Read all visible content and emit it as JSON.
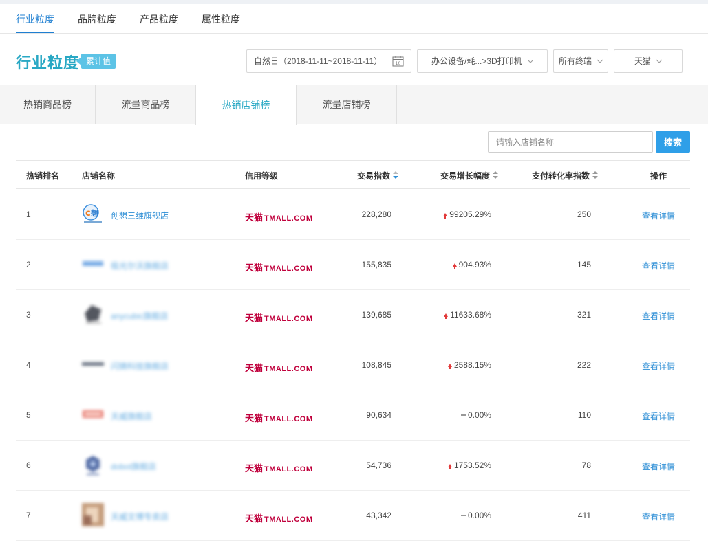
{
  "subnav": {
    "items": [
      "行业粒度",
      "品牌粒度",
      "产品粒度",
      "属性粒度"
    ],
    "active_index": 0
  },
  "header": {
    "title": "行业粒度",
    "badge": "累计值"
  },
  "filters": {
    "date": "自然日（2018-11-11~2018-11-11）",
    "category": "办公设备/耗...>3D打印机",
    "terminal": "所有终端",
    "platform": "天猫"
  },
  "tabs": {
    "items": [
      "热销商品榜",
      "流量商品榜",
      "热销店铺榜",
      "流量店铺榜"
    ],
    "active_index": 2
  },
  "search": {
    "placeholder": "请输入店铺名称",
    "button": "搜索"
  },
  "table": {
    "columns": {
      "rank": "热销排名",
      "shop": "店铺名称",
      "credit": "信用等级",
      "trade": "交易指数",
      "growth": "交易增长幅度",
      "conversion": "支付转化率指数",
      "action": "操作"
    },
    "credit_label_zh": "天猫",
    "credit_label_en": "TMALL.COM",
    "action_label": "查看详情",
    "rows": [
      {
        "rank": "1",
        "shop": "创想三维旗舰店",
        "blurred": false,
        "trade": "228,280",
        "growth": "99205.29%",
        "trend": "up",
        "conversion": "250"
      },
      {
        "rank": "2",
        "shop": "极光尔沃旗舰店",
        "blurred": true,
        "trade": "155,835",
        "growth": "904.93%",
        "trend": "up",
        "conversion": "145"
      },
      {
        "rank": "3",
        "shop": "anycubic旗舰店",
        "blurred": true,
        "trade": "139,685",
        "growth": "11633.68%",
        "trend": "up",
        "conversion": "321"
      },
      {
        "rank": "4",
        "shop": "闪铸科技旗舰店",
        "blurred": true,
        "trade": "108,845",
        "growth": "2588.15%",
        "trend": "up",
        "conversion": "222"
      },
      {
        "rank": "5",
        "shop": "天威旗舰店",
        "blurred": true,
        "trade": "90,634",
        "growth": "0.00%",
        "trend": "flat",
        "conversion": "110"
      },
      {
        "rank": "6",
        "shop": "dobot旗舰店",
        "blurred": true,
        "trade": "54,736",
        "growth": "1753.52%",
        "trend": "up",
        "conversion": "78"
      },
      {
        "rank": "7",
        "shop": "天威文博专卖店",
        "blurred": true,
        "trade": "43,342",
        "growth": "0.00%",
        "trend": "flat",
        "conversion": "411"
      }
    ]
  },
  "colors": {
    "accent": "#29a8c4",
    "link": "#2f8fd6",
    "tmall": "#c0003c",
    "up_arrow": "#e23a3a",
    "search_button": "#2f9fe8"
  }
}
